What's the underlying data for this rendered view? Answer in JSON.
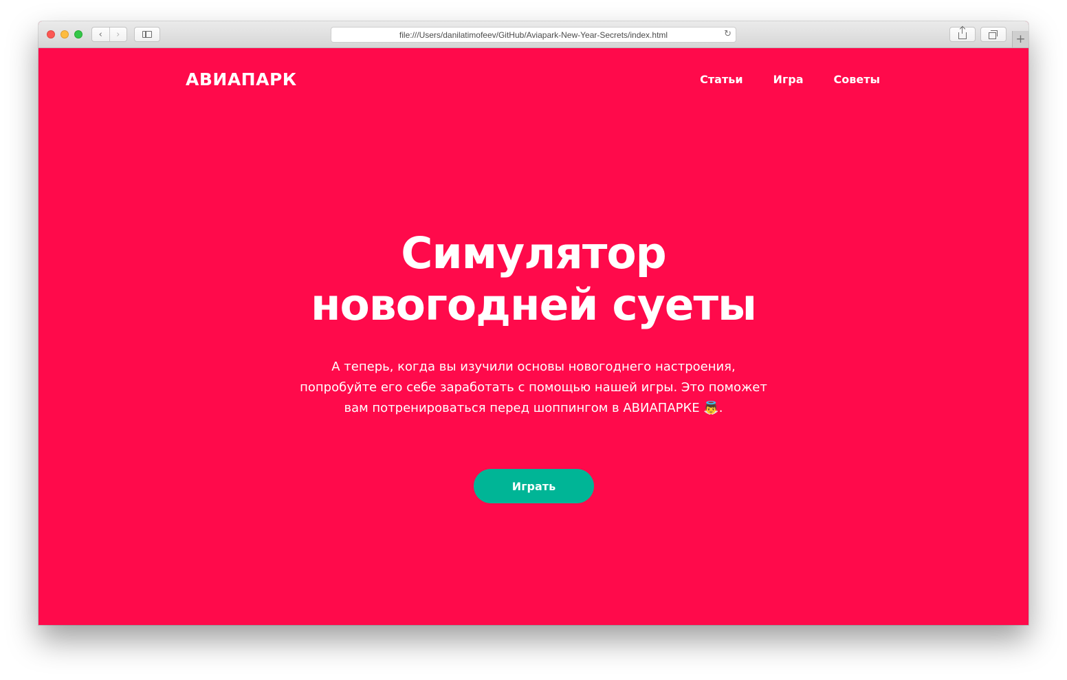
{
  "browser": {
    "url": "file:///Users/danilatimofeev/GitHub/Aviapark-New-Year-Secrets/index.html",
    "back_icon": "chevron-left-icon",
    "forward_icon": "chevron-right-icon",
    "reload_icon": "reload-icon",
    "back_glyph": "‹",
    "forward_glyph": "›",
    "reload_glyph": "↻",
    "new_tab_glyph": "+"
  },
  "header": {
    "logo": "АВИАПАРК",
    "nav": [
      "Статьи",
      "Игра",
      "Советы"
    ]
  },
  "hero": {
    "title_lines": [
      "Симулятор",
      "новогодней суеты"
    ],
    "text_lines": [
      "А теперь, когда вы изучили основы новогоднего настроения,",
      "попробуйте его себе заработать с помощью нашей игры. Это поможет",
      "вам потренироваться перед шоппингом в АВИАПАРКЕ 👼."
    ],
    "button_label": "Играть"
  },
  "colors": {
    "background": "#ff0a4b",
    "button": "#00b596",
    "text": "#ffffff"
  }
}
